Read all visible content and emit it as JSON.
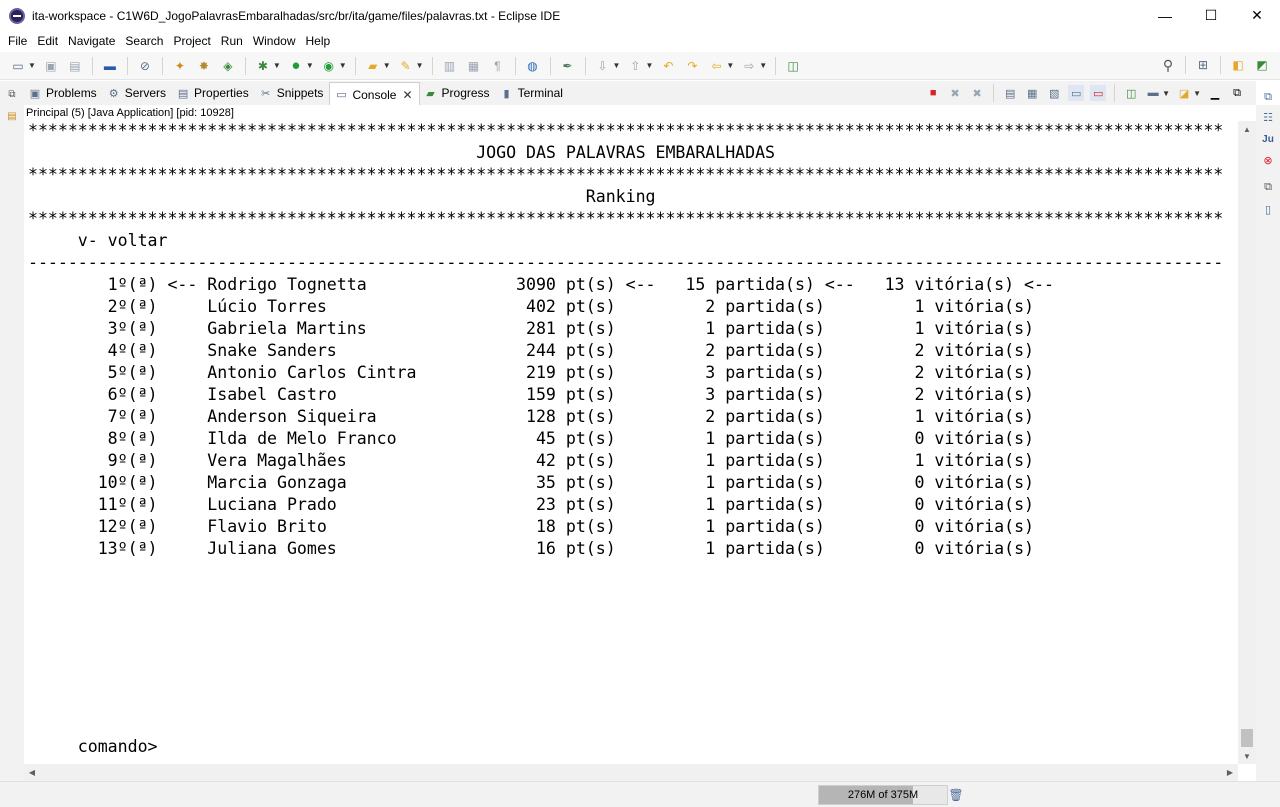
{
  "window": {
    "title": "ita-workspace - C1W6D_JogoPalavrasEmbaralhadas/src/br/ita/game/files/palavras.txt - Eclipse IDE",
    "minimize": "—",
    "maximize": "☐",
    "close": "✕"
  },
  "menu": [
    "File",
    "Edit",
    "Navigate",
    "Search",
    "Project",
    "Run",
    "Window",
    "Help"
  ],
  "tabs": [
    {
      "label": "Problems",
      "icon": "problems-icon",
      "glyph": "▣"
    },
    {
      "label": "Servers",
      "icon": "servers-icon",
      "glyph": "⚙"
    },
    {
      "label": "Properties",
      "icon": "properties-icon",
      "glyph": "▤"
    },
    {
      "label": "Snippets",
      "icon": "snippets-icon",
      "glyph": "✂"
    },
    {
      "label": "Console",
      "icon": "console-icon",
      "glyph": "▭",
      "active": true,
      "close": "✕"
    },
    {
      "label": "Progress",
      "icon": "progress-icon",
      "glyph": "▰"
    },
    {
      "label": "Terminal",
      "icon": "terminal-icon",
      "glyph": "▮"
    }
  ],
  "console": {
    "header": "Principal (5) [Java Application]  [pid: 10928]",
    "lines": [
      "************************************************************************************************************************",
      "                                             JOGO DAS PALAVRAS EMBARALHADAS",
      "************************************************************************************************************************",
      "                                                        Ranking",
      "************************************************************************************************************************",
      "     v- voltar",
      "------------------------------------------------------------------------------------------------------------------------",
      "        1º(ª) <-- Rodrigo Tognetta               3090 pt(s) <--   15 partida(s) <--   13 vitória(s) <--",
      "        2º(ª)     Lúcio Torres                    402 pt(s)         2 partida(s)         1 vitória(s)",
      "        3º(ª)     Gabriela Martins                281 pt(s)         1 partida(s)         1 vitória(s)",
      "        4º(ª)     Snake Sanders                   244 pt(s)         2 partida(s)         2 vitória(s)",
      "        5º(ª)     Antonio Carlos Cintra           219 pt(s)         3 partida(s)         2 vitória(s)",
      "        6º(ª)     Isabel Castro                   159 pt(s)         3 partida(s)         2 vitória(s)",
      "        7º(ª)     Anderson Siqueira               128 pt(s)         2 partida(s)         1 vitória(s)",
      "        8º(ª)     Ilda de Melo Franco              45 pt(s)         1 partida(s)         0 vitória(s)",
      "        9º(ª)     Vera Magalhães                   42 pt(s)         1 partida(s)         1 vitória(s)",
      "       10º(ª)     Marcia Gonzaga                   35 pt(s)         1 partida(s)         0 vitória(s)",
      "       11º(ª)     Luciana Prado                    23 pt(s)         1 partida(s)         0 vitória(s)",
      "       12º(ª)     Flavio Brito                     18 pt(s)         1 partida(s)         0 vitória(s)",
      "       13º(ª)     Juliana Gomes                    16 pt(s)         1 partida(s)         0 vitória(s)",
      "",
      "",
      "",
      "",
      "",
      "",
      "",
      "",
      "     comando>"
    ]
  },
  "status": {
    "heap_label": "276M of 375M",
    "heap_used_fraction": 0.736
  },
  "colors": {
    "terminate_red": "#d9202a",
    "run_green": "#1f9d3b",
    "folder_yellow": "#e4a92a"
  }
}
